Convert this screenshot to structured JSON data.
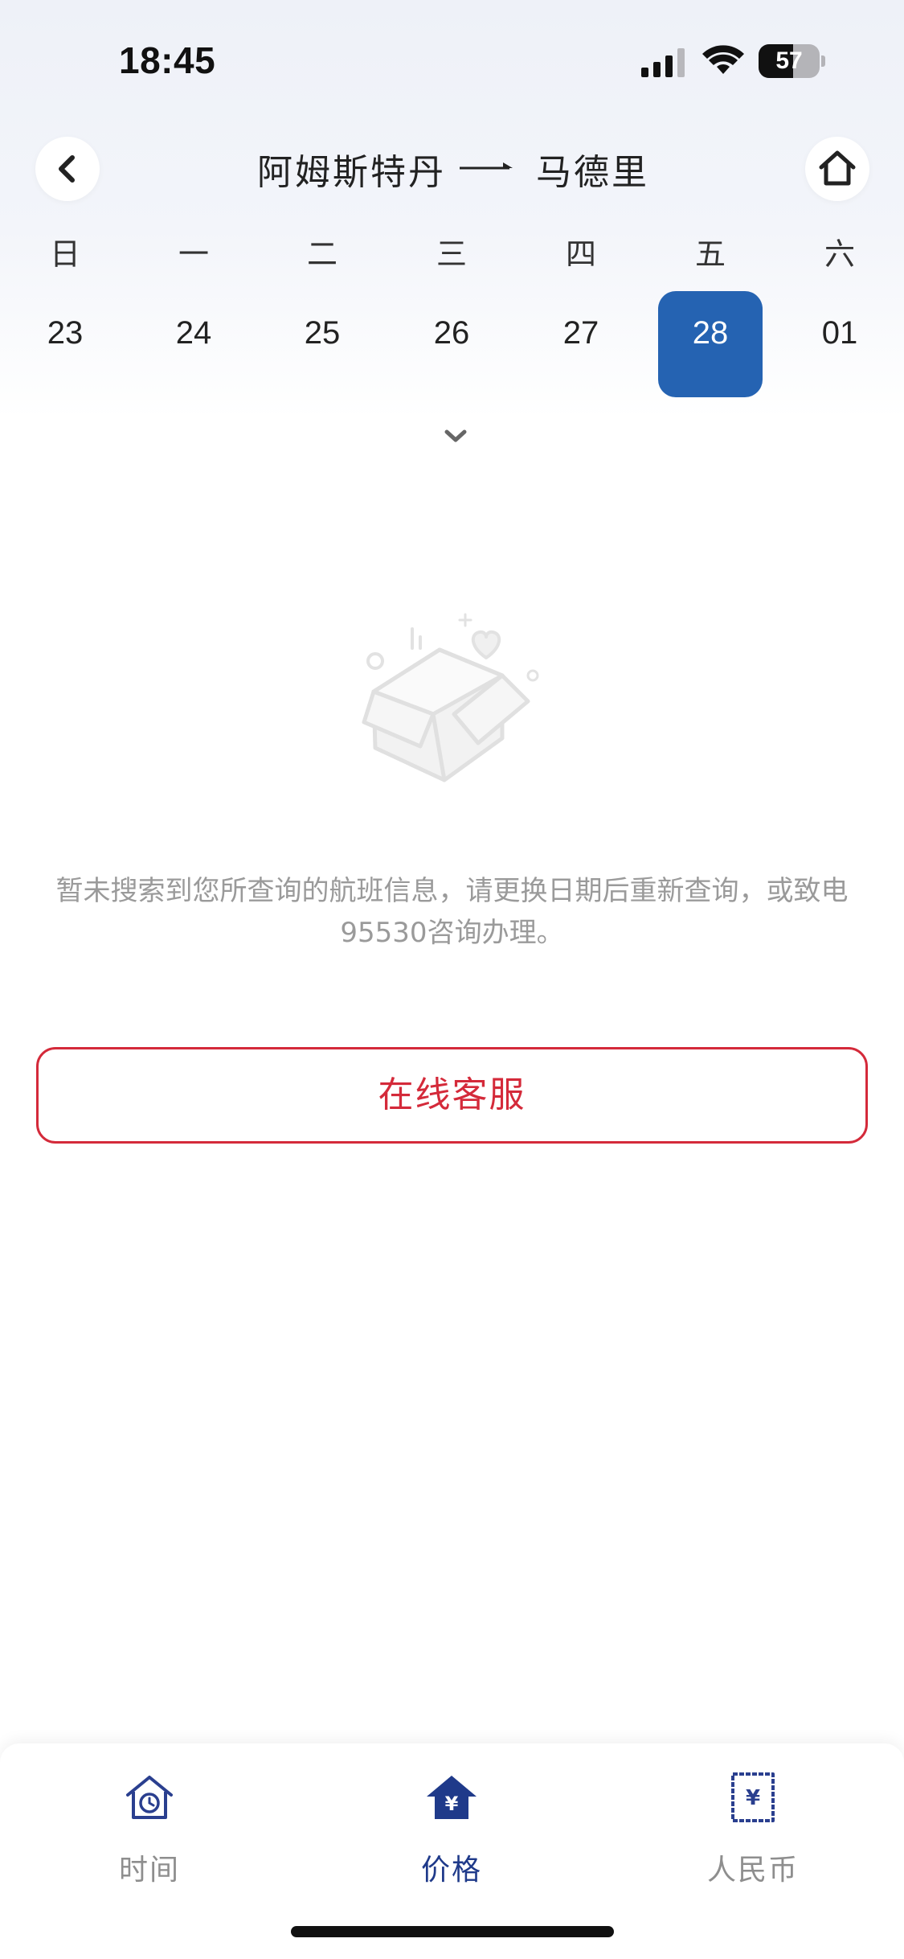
{
  "status_bar": {
    "time": "18:45",
    "battery_level": "57",
    "battery_fraction": 0.57,
    "icons": [
      "signal-icon",
      "wifi-icon",
      "battery-icon"
    ]
  },
  "nav": {
    "back_icon": "chevron-left-icon",
    "home_icon": "home-icon",
    "from_city": "阿姆斯特丹",
    "to_city": "马德里",
    "arrow_icon": "arrow-right-icon"
  },
  "calendar": {
    "weekdays": [
      "日",
      "一",
      "二",
      "三",
      "四",
      "五",
      "六"
    ],
    "dates": [
      "23",
      "24",
      "25",
      "26",
      "27",
      "28",
      "01"
    ],
    "selected_date": "28",
    "expand_icon": "chevron-down-icon"
  },
  "empty_state": {
    "illustration_icon": "empty-box-icon",
    "message": "暂未搜索到您所查询的航班信息，请更换日期后重新查询，或致电95530咨询办理。"
  },
  "online_service_button": "在线客服",
  "tabs": [
    {
      "label": "时间",
      "icon": "clock-house-icon",
      "active": false
    },
    {
      "label": "价格",
      "icon": "yen-house-icon",
      "active": true
    },
    {
      "label": "人民币",
      "icon": "yen-receipt-icon",
      "active": false
    }
  ],
  "colors": {
    "accent_blue": "#2563b2",
    "tab_active": "#1f3a8a",
    "service_red": "#d42a3a",
    "hint_gray": "#9a9a9a"
  }
}
